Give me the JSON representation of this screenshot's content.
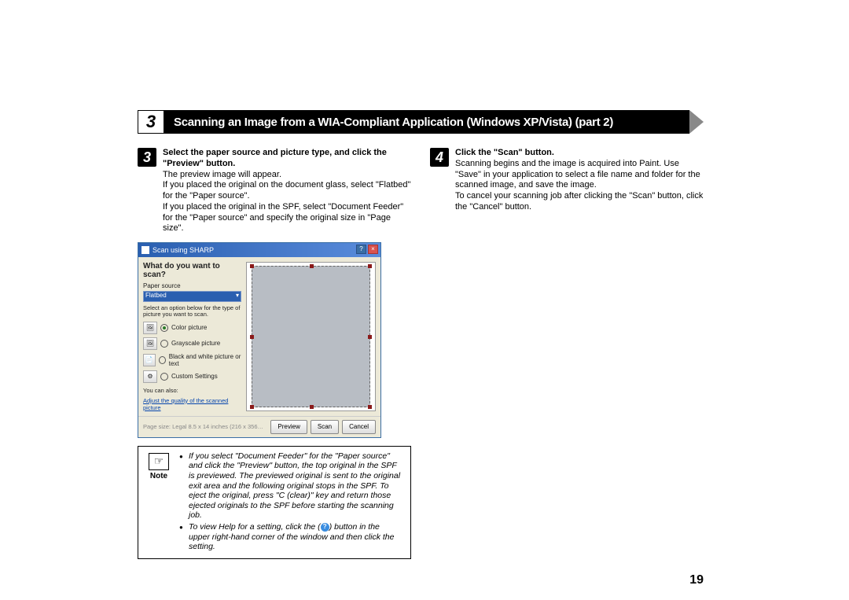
{
  "header": {
    "section_number": "3",
    "title": "Scanning an Image from a WIA-Compliant Application (Windows XP/Vista) (part 2)"
  },
  "left_step": {
    "number": "3",
    "title": "Select the paper source and picture type, and click the \"Preview\" button.",
    "line1": "The preview image will appear.",
    "line2": "If you placed the original on the document glass, select \"Flatbed\" for the \"Paper source\".",
    "line3": "If you placed the original in the SPF, select \"Document Feeder\" for the \"Paper source\" and specify the original size in \"Page size\"."
  },
  "dialog": {
    "title": "Scan using SHARP",
    "heading": "What do you want to scan?",
    "paper_source_label": "Paper source",
    "paper_source_value": "Flatbed",
    "subtext": "Select an option below for the type of picture you want to scan.",
    "opt_color": "Color picture",
    "opt_gray": "Grayscale picture",
    "opt_bw": "Black and white picture or text",
    "opt_custom": "Custom Settings",
    "also_label": "You can also:",
    "adjust_link": "Adjust the quality of the scanned picture",
    "footer_info": "Page size:   Legal 8.5 x 14 inches (216 x 356…",
    "btn_preview": "Preview",
    "btn_scan": "Scan",
    "btn_cancel": "Cancel"
  },
  "note": {
    "label": "Note",
    "bullet1": "If you select \"Document Feeder\" for the \"Paper source\" and click the \"Preview\" button, the top original in the SPF is previewed. The previewed original is sent to the original exit area and the following original stops in the SPF. To eject the original, press \"C (clear)\" key and return those ejected originals to the SPF before starting the scanning job.",
    "bullet2a": "To view Help for a setting, click the (",
    "bullet2_icon": "?",
    "bullet2b": ") button in the upper right-hand corner of the window and then click the setting."
  },
  "right_step": {
    "number": "4",
    "title": "Click the \"Scan\" button.",
    "line1": "Scanning begins and the image is acquired into Paint. Use \"Save\" in your application to select a file name and folder for the scanned image, and save the image.",
    "line2": "To cancel your scanning job after clicking the \"Scan\" button, click the \"Cancel\" button."
  },
  "page_number": "19"
}
